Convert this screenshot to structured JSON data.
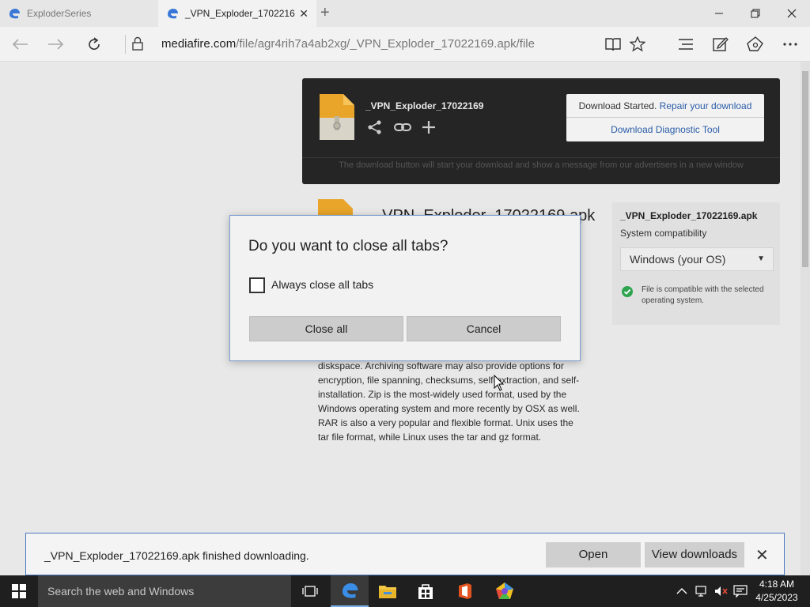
{
  "browser": {
    "tabs": [
      {
        "label": "ExploderSeries"
      },
      {
        "label": "_VPN_Exploder_1702216"
      }
    ],
    "url_host": "mediafire.com",
    "url_path": "/file/agr4rih7a4ab2xg/_VPN_Exploder_17022169.apk/file"
  },
  "download_card": {
    "filename": "_VPN_Exploder_17022169",
    "started_text": "Download Started.",
    "repair_link": "Repair your download",
    "diagnostic_link": "Download Diagnostic Tool",
    "disclaimer": "The download button will start your download and show a message from our advertisers in a new window"
  },
  "file_title": "_VPN_Exploder_17022169.apk",
  "compat": {
    "filename": "_VPN_Exploder_17022169.apk",
    "label": "System compatibility",
    "selected_os": "Windows (your OS)",
    "message": "File is compatible with the selected operating system."
  },
  "body_text": "diskspace. Archiving software may also provide options for encryption, file spanning, checksums, self-extraction, and self-installation. Zip is the most-widely used format, used by the Windows operating system and more recently by OSX as well. RAR is also a very popular and flexible format. Unix uses the tar file format, while Linux uses the tar and gz format.",
  "dialog": {
    "title": "Do you want to close all tabs?",
    "checkbox_label": "Always close all tabs",
    "checkbox_checked": false,
    "primary_button": "Close all",
    "secondary_button": "Cancel"
  },
  "notification": {
    "message": "_VPN_Exploder_17022169.apk finished downloading.",
    "open_button": "Open",
    "view_button": "View downloads"
  },
  "taskbar": {
    "search_placeholder": "Search the web and Windows",
    "time": "4:18 AM",
    "date": "4/25/2023"
  },
  "icons": [
    "edge-icon",
    "back-icon",
    "forward-icon",
    "refresh-icon",
    "lock-icon",
    "reading-view-icon",
    "favorite-star-icon",
    "hub-icon",
    "web-note-icon",
    "share-icon",
    "more-icon",
    "windows-start-icon",
    "task-view-icon",
    "file-explorer-icon",
    "store-icon",
    "office-icon",
    "app-icon"
  ],
  "colors": {
    "link": "#2a5ca8",
    "dialog_border": "#7a9cd0",
    "notification_border": "#4a78c2",
    "ok_green": "#2ea44f"
  }
}
